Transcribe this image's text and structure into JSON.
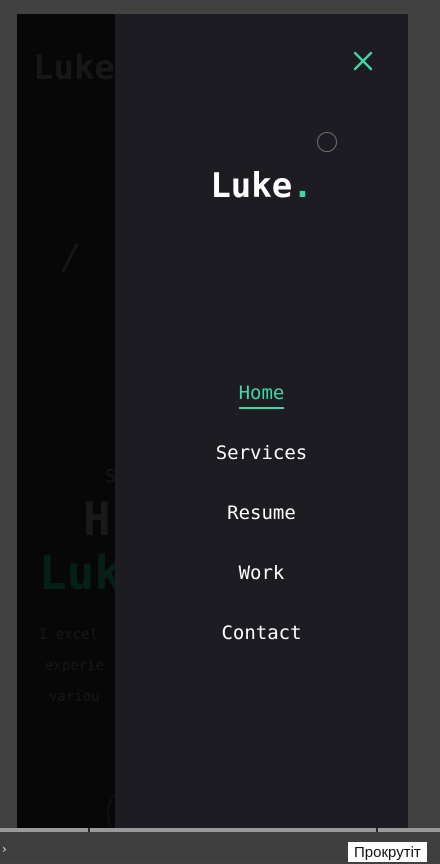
{
  "background": {
    "logo": "Luke",
    "slash": "/",
    "subtitle": "S",
    "heading": "H",
    "name": "Luk",
    "paragraph": [
      "I excel",
      "experie",
      "variou"
    ]
  },
  "menu": {
    "logo_text": "Luke",
    "logo_dot": ".",
    "close_icon": "close-icon",
    "items": [
      {
        "label": "Home",
        "active": true
      },
      {
        "label": "Services",
        "active": false
      },
      {
        "label": "Resume",
        "active": false
      },
      {
        "label": "Work",
        "active": false
      },
      {
        "label": "Contact",
        "active": false
      }
    ]
  },
  "tooltip": {
    "text": "Прокрутіт"
  },
  "colors": {
    "accent": "#3fd7a6",
    "panel": "#1c1c22",
    "page": "#050505"
  }
}
